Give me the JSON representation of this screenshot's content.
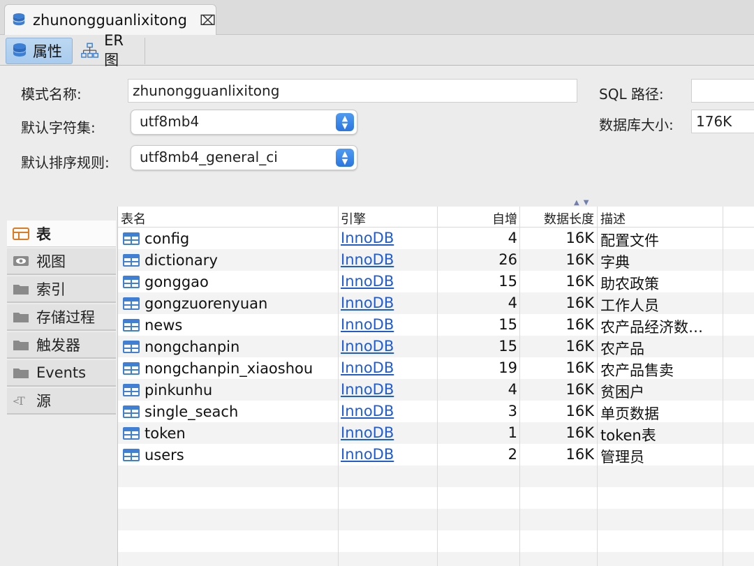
{
  "window": {
    "doc_tab_title": "zhunongguanlixitong",
    "close_glyph": "⌧"
  },
  "subtabs": [
    {
      "label": "属性",
      "icon": "database-icon",
      "active": true
    },
    {
      "label": "ER 图",
      "icon": "er-diagram-icon",
      "active": false
    }
  ],
  "properties": {
    "schema_name_label": "模式名称:",
    "schema_name_value": "zhunongguanlixitong",
    "charset_label": "默认字符集:",
    "charset_value": "utf8mb4",
    "collation_label": "默认排序规则:",
    "collation_value": "utf8mb4_general_ci",
    "sql_path_label": "SQL 路径:",
    "sql_path_value": "",
    "db_size_label": "数据库大小:",
    "db_size_value": "176K"
  },
  "side_tabs": [
    {
      "label": "表",
      "icon": "table-icon",
      "active": true
    },
    {
      "label": "视图",
      "icon": "view-eye-icon",
      "active": false
    },
    {
      "label": "索引",
      "icon": "folder-icon",
      "active": false
    },
    {
      "label": "存储过程",
      "icon": "folder-icon",
      "active": false
    },
    {
      "label": "触发器",
      "icon": "folder-icon",
      "active": false
    },
    {
      "label": "Events",
      "icon": "folder-icon",
      "active": false
    },
    {
      "label": "源",
      "icon": "source-text-icon",
      "active": false
    }
  ],
  "table": {
    "columns": [
      "表名",
      "引擎",
      "自增",
      "数据长度",
      "描述"
    ],
    "rows": [
      {
        "name": "config",
        "engine": "InnoDB",
        "auto_increment": "4",
        "data_length": "16K",
        "description": "配置文件"
      },
      {
        "name": "dictionary",
        "engine": "InnoDB",
        "auto_increment": "26",
        "data_length": "16K",
        "description": "字典"
      },
      {
        "name": "gonggao",
        "engine": "InnoDB",
        "auto_increment": "15",
        "data_length": "16K",
        "description": "助农政策"
      },
      {
        "name": "gongzuorenyuan",
        "engine": "InnoDB",
        "auto_increment": "4",
        "data_length": "16K",
        "description": "工作人员"
      },
      {
        "name": "news",
        "engine": "InnoDB",
        "auto_increment": "15",
        "data_length": "16K",
        "description": "农产品经济数…"
      },
      {
        "name": "nongchanpin",
        "engine": "InnoDB",
        "auto_increment": "15",
        "data_length": "16K",
        "description": "农产品"
      },
      {
        "name": "nongchanpin_xiaoshou",
        "engine": "InnoDB",
        "auto_increment": "19",
        "data_length": "16K",
        "description": "农产品售卖"
      },
      {
        "name": "pinkunhu",
        "engine": "InnoDB",
        "auto_increment": "4",
        "data_length": "16K",
        "description": "贫困户"
      },
      {
        "name": "single_seach",
        "engine": "InnoDB",
        "auto_increment": "3",
        "data_length": "16K",
        "description": "单页数据"
      },
      {
        "name": "token",
        "engine": "InnoDB",
        "auto_increment": "1",
        "data_length": "16K",
        "description": "token表"
      },
      {
        "name": "users",
        "engine": "InnoDB",
        "auto_increment": "2",
        "data_length": "16K",
        "description": "管理员"
      }
    ]
  },
  "colors": {
    "link": "#1e5bd6",
    "active_subtab": "#bcd8f2",
    "stepper": "#2a76e0",
    "table_icon": "#3f7fd6"
  }
}
